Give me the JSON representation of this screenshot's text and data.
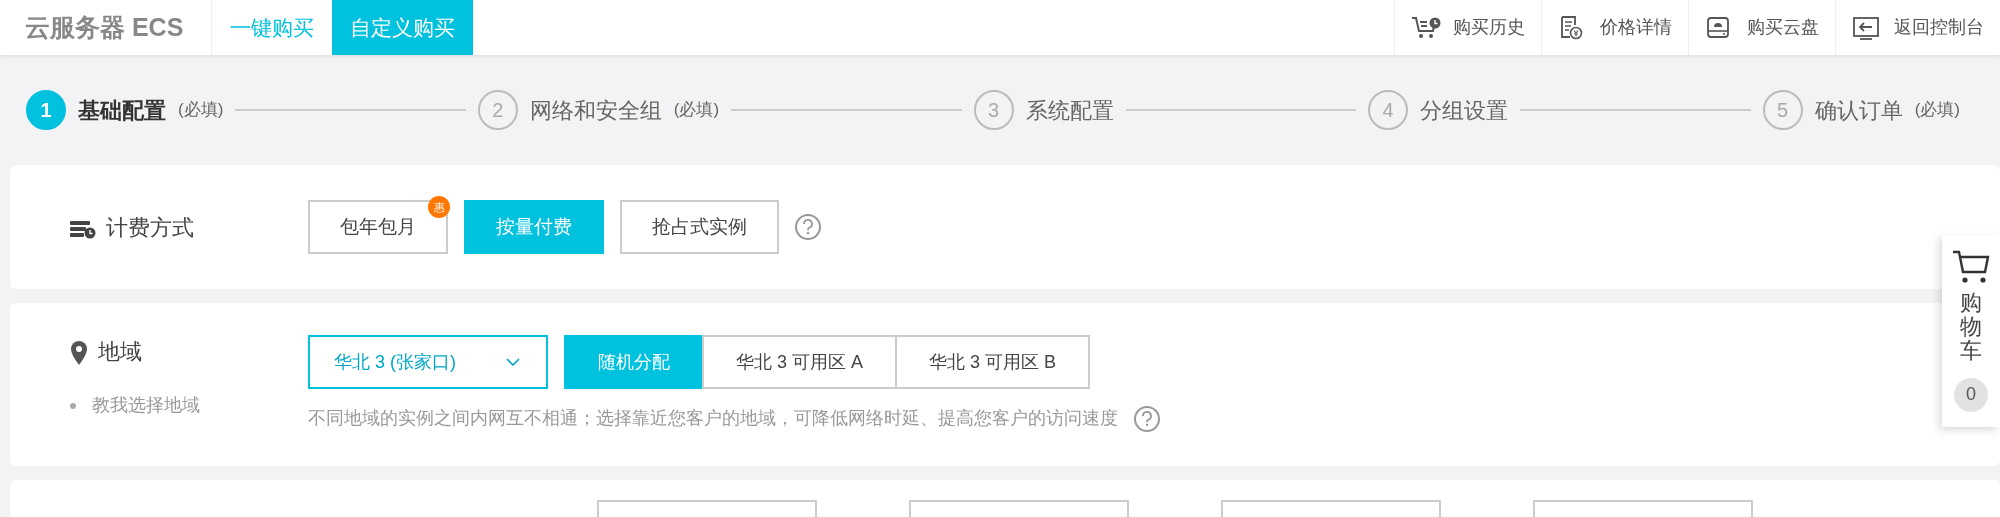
{
  "header": {
    "product_title": "云服务器 ECS",
    "tabs": [
      {
        "label": "一键购买",
        "selected": false
      },
      {
        "label": "自定义购买",
        "selected": true
      }
    ],
    "links": [
      {
        "label": "购买历史",
        "kind": "history"
      },
      {
        "label": "价格详情",
        "kind": "price"
      },
      {
        "label": "购买云盘",
        "kind": "disk"
      },
      {
        "label": "返回控制台",
        "kind": "console"
      }
    ]
  },
  "steps": [
    {
      "number": "1",
      "label": "基础配置",
      "note": "(必填)",
      "selected": true
    },
    {
      "number": "2",
      "label": "网络和安全组",
      "note": "(必填)",
      "selected": false
    },
    {
      "number": "3",
      "label": "系统配置",
      "selected": false
    },
    {
      "number": "4",
      "label": "分组设置",
      "selected": false
    },
    {
      "number": "5",
      "label": "确认订单",
      "note": "(必填)",
      "selected": false
    }
  ],
  "billing": {
    "label": "计费方式",
    "options": [
      {
        "label": "包年包月",
        "badge": "惠",
        "selected": false
      },
      {
        "label": "按量付费",
        "selected": true
      },
      {
        "label": "抢占式实例",
        "selected": false
      }
    ]
  },
  "region": {
    "label": "地域",
    "help_link": "教我选择地域",
    "select_value": "华北 3 (张家口)",
    "zones": [
      {
        "label": "随机分配",
        "selected": true
      },
      {
        "label": "华北 3 可用区 A",
        "selected": false
      },
      {
        "label": "华北 3 可用区 B",
        "selected": false
      }
    ],
    "hint": "不同地域的实例之间内网互不相通；选择靠近您客户的地域，可降低网络时延、提高您客户的访问速度"
  },
  "next_card": {
    "options": [
      {
        "selected": false
      },
      {
        "selected": false
      },
      {
        "selected": false
      },
      {
        "selected": false
      }
    ]
  },
  "cart": {
    "label": "购物车",
    "count": "0"
  }
}
